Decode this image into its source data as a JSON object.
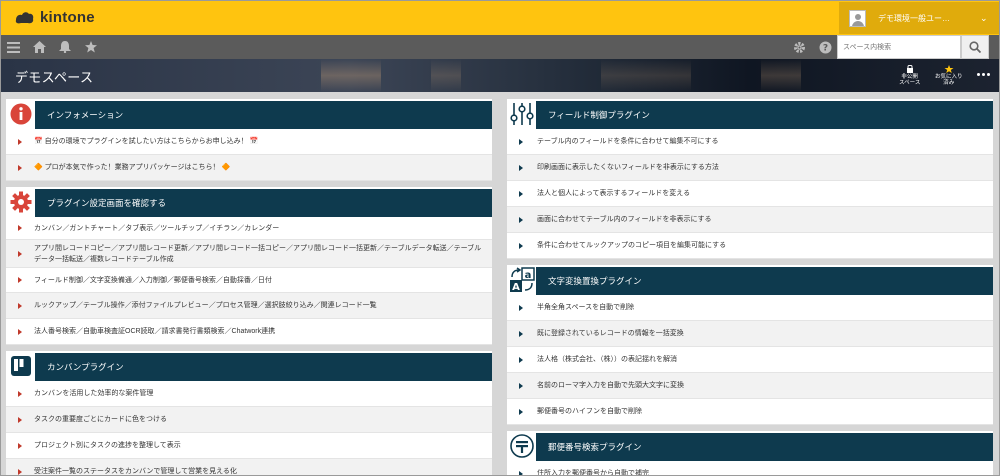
{
  "app": {
    "logo_text": "kintone"
  },
  "header": {
    "user_name": "デモ環境一般ユー…",
    "search_placeholder": "スペース内検索"
  },
  "banner": {
    "title": "デモスペース",
    "actions": [
      {
        "label_line1": "非公開",
        "label_line2": "スペース"
      },
      {
        "label_line1": "お気に入り",
        "label_line2": "済み"
      }
    ]
  },
  "left": [
    {
      "title": "インフォメーション",
      "icon": "info-icon",
      "items": [
        {
          "text": "📅 自分の環境でプラグインを試したい方はこちらからお申し込み！ 📅",
          "height": 26
        },
        {
          "text": "🔶 プロが本気で作った！業務アプリパッケージはこちら！ 🔶",
          "height": 26
        }
      ]
    },
    {
      "title": "プラグイン設定画面を確認する",
      "icon": "gear-icon",
      "items": [
        {
          "text": "カンバン／ガントチャート／タブ表示／ツールチップ／イチラン／カレンダー",
          "height": 23
        },
        {
          "text": "アプリ間レコードコピー／アプリ間レコード更新／アプリ間レコード一括コピー／アプリ間レコード一括更新／テーブルデータ転送／テーブルデータ一括転送／複数レコードテーブル作成",
          "height": 28
        },
        {
          "text": "フィールド制御／文字変換備通／入力制御／郵便番号検索／自動採番／日付",
          "height": 25
        },
        {
          "text": "ルックアップ／テーブル操作／添付ファイルプレビュー／プロセス管理／選択肢絞り込み／関連レコード一覧",
          "height": 26
        },
        {
          "text": "法人番号検索／自動車検査証OCR読取／請求書発行書類検索／Chatwork連携",
          "height": 26
        }
      ]
    },
    {
      "title": "カンバンプラグイン",
      "icon": "kanban-icon",
      "items": [
        {
          "text": "カンバンを活用した効率的な案件管理",
          "height": 26
        },
        {
          "text": "タスクの重要度ごとにカードに色をつける",
          "height": 26
        },
        {
          "text": "プロジェクト別にタスクの進捗を整理して表示",
          "height": 26
        },
        {
          "text": "受注案件一覧のステータスをカンバンで管理して営業を見える化",
          "height": 26
        }
      ]
    }
  ],
  "right": [
    {
      "title": "フィールド制御プラグイン",
      "icon": "sliders-icon",
      "items": [
        {
          "text": "テーブル内のフィールドを条件に合わせて編集不可にする",
          "height": 26
        },
        {
          "text": "印刷画面に表示したくないフィールドを非表示にする方法",
          "height": 26
        },
        {
          "text": "法人と個人によって表示するフィールドを変える",
          "height": 26
        },
        {
          "text": "画面に合わせてテーブル内のフィールドを非表示にする",
          "height": 26
        },
        {
          "text": "条件に合わせてルックアップのコピー項目を編集可能にする",
          "height": 26
        }
      ]
    },
    {
      "title": "文字変換置換プラグイン",
      "icon": "text-convert-icon",
      "items": [
        {
          "text": "半角全角スペースを自動で削除",
          "height": 26
        },
        {
          "text": "既に登録されているレコードの情報を一括変換",
          "height": 26
        },
        {
          "text": "法人格（株式会社、（株））の表記揺れを解消",
          "height": 26
        },
        {
          "text": "名前のローマ字入力を自動で先頭大文字に変換",
          "height": 26
        },
        {
          "text": "郵便番号のハイフンを自動で削除",
          "height": 26
        }
      ]
    },
    {
      "title": "郵便番号検索プラグイン",
      "icon": "postal-icon",
      "items": [
        {
          "text": "住所入力を郵便番号から自動で補完",
          "height": 26
        }
      ]
    }
  ],
  "colors": {
    "topbar": "#ffc40f",
    "section_header": "#0e3a4e",
    "bullet_left": "#c0392b",
    "bullet_right": "#0e3a4e",
    "info_red": "#d9453a"
  }
}
